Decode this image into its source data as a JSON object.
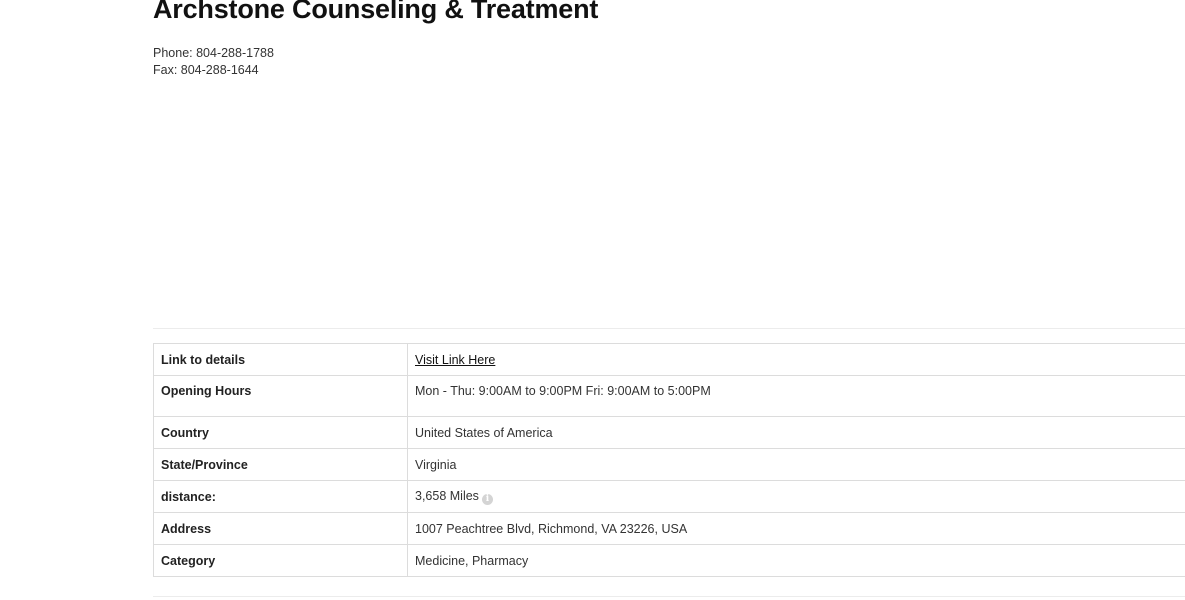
{
  "listing": {
    "title": "Archstone Counseling & Treatment",
    "phone_line": "Phone: 804-288-1788",
    "fax_line": "Fax: 804-288-1644"
  },
  "details": {
    "link": {
      "label": "Link to details",
      "value": "Visit Link Here"
    },
    "hours": {
      "label": "Opening Hours",
      "value": "Mon - Thu: 9:00AM to 9:00PM Fri: 9:00AM to 5:00PM"
    },
    "country": {
      "label": "Country",
      "value": "United States of America"
    },
    "state": {
      "label": "State/Province",
      "value": "Virginia"
    },
    "distance": {
      "label": "distance:",
      "value": "3,658 Miles",
      "icon": "info-icon"
    },
    "address": {
      "label": "Address",
      "value": "1007 Peachtree Blvd, Richmond, VA 23226, USA"
    },
    "category": {
      "label": "Category",
      "value": "Medicine, Pharmacy"
    }
  }
}
